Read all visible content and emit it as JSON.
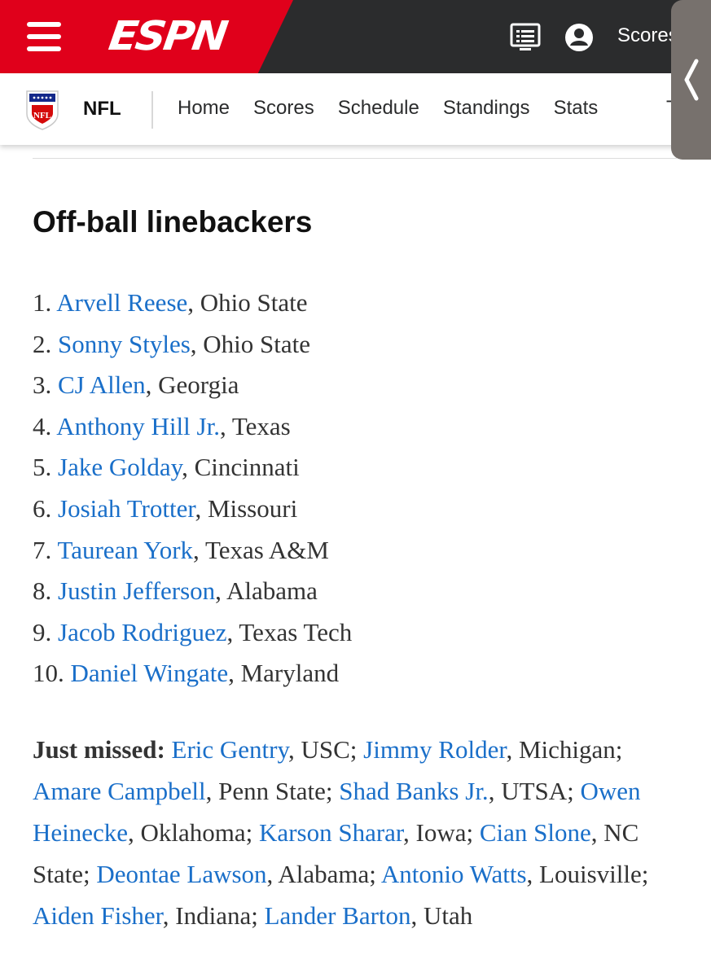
{
  "brand": {
    "logo_text": "ESPN",
    "scores_label": "Scores",
    "accent_red": "#e0001b",
    "topbar_bg": "#2b2c2d",
    "link_color": "#1a6fc9"
  },
  "icons": {
    "menu": "hamburger-menu-icon",
    "watch": "tv-screen-icon",
    "profile": "user-account-icon",
    "collapse": "chevron-left-icon",
    "league": "nfl-shield-logo"
  },
  "subnav": {
    "league_label": "NFL",
    "links": [
      "Home",
      "Scores",
      "Schedule",
      "Standings",
      "Stats"
    ],
    "more_fragment": "T"
  },
  "article": {
    "heading": "Off-ball linebackers",
    "ranking": [
      {
        "rank": "1.",
        "name": "Arvell Reese",
        "school": ", Ohio State"
      },
      {
        "rank": "2.",
        "name": "Sonny Styles",
        "school": ", Ohio State"
      },
      {
        "rank": "3.",
        "name": "CJ Allen",
        "school": ", Georgia"
      },
      {
        "rank": "4.",
        "name": "Anthony Hill Jr.",
        "school": ", Texas"
      },
      {
        "rank": "5.",
        "name": "Jake Golday",
        "school": ", Cincinnati"
      },
      {
        "rank": "6.",
        "name": "Josiah Trotter",
        "school": ", Missouri"
      },
      {
        "rank": "7.",
        "name": "Taurean York",
        "school": ", Texas A&M"
      },
      {
        "rank": "8.",
        "name": "Justin Jefferson",
        "school": ", Alabama"
      },
      {
        "rank": "9.",
        "name": "Jacob Rodriguez",
        "school": ", Texas Tech"
      },
      {
        "rank": "10.",
        "name": "Daniel Wingate",
        "school": ", Maryland"
      }
    ],
    "just_missed_label": "Just missed:",
    "just_missed": [
      {
        "name": "Eric Gentry",
        "school": ", USC;"
      },
      {
        "name": "Jimmy Rolder",
        "school": ", Michigan;"
      },
      {
        "name": "Amare Campbell",
        "school": ", Penn State;"
      },
      {
        "name": "Shad Banks Jr.",
        "school": ", UTSA;"
      },
      {
        "name": "Owen Heinecke",
        "school": ", Oklahoma;"
      },
      {
        "name": "Karson Sharar",
        "school": ", Iowa;"
      },
      {
        "name": "Cian Slone",
        "school": ", NC State;"
      },
      {
        "name": "Deontae Lawson",
        "school": ", Alabama;"
      },
      {
        "name": "Antonio Watts",
        "school": ", Louisville;"
      },
      {
        "name": "Aiden Fisher",
        "school": ", Indiana;"
      },
      {
        "name": "Lander Barton",
        "school": ", Utah"
      }
    ]
  }
}
